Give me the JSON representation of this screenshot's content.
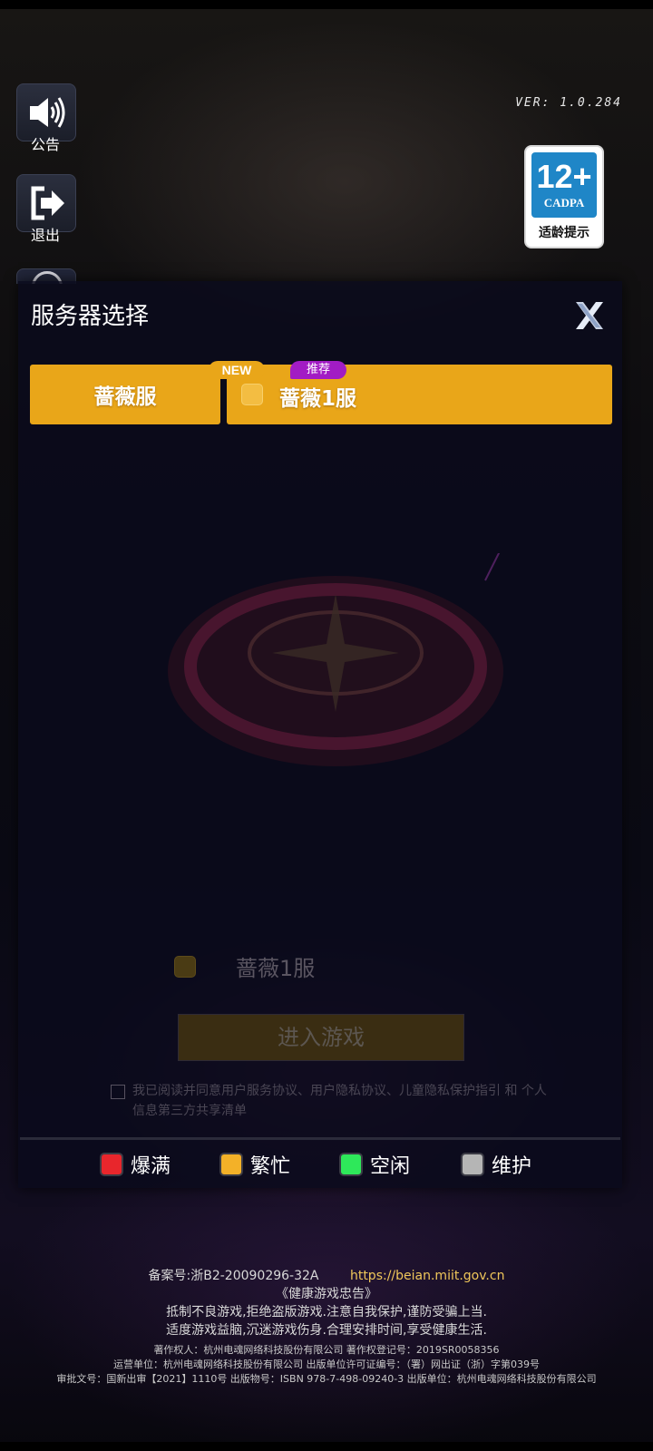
{
  "side_buttons": {
    "announcement": {
      "icon": "speaker-icon",
      "label": "公告"
    },
    "exit": {
      "icon": "exit-icon",
      "label": "退出"
    }
  },
  "version": "VER: 1.0.284",
  "age_rating": {
    "age": "12+",
    "org": "CADPA",
    "tip": "适龄提示",
    "color": "#1f86c7"
  },
  "dialog": {
    "title": "服务器选择",
    "close_icon": "close-x-icon",
    "server_groups": [
      {
        "label": "蔷薇服"
      }
    ],
    "servers": [
      {
        "name": "蔷薇1服",
        "tags": [
          "NEW",
          "推荐"
        ],
        "status": "繁忙"
      }
    ],
    "accent_color": "#e9a619"
  },
  "background": {
    "selected_server": "蔷薇1服",
    "enter_button": "进入游戏",
    "agreement": "我已阅读并同意用户服务协议、用户隐私协议、儿童隐私保护指引 和 个人信息第三方共享清单"
  },
  "legend": [
    {
      "label": "爆满",
      "color": "#e8262c"
    },
    {
      "label": "繁忙",
      "color": "#f3b128"
    },
    {
      "label": "空闲",
      "color": "#2ee85a"
    },
    {
      "label": "维护",
      "color": "#b5b5b5"
    }
  ],
  "footer": {
    "icp": "备案号:浙B2-20090296-32A",
    "icp_url": "https://beian.miit.gov.cn",
    "health_title": "《健康游戏忠告》",
    "advice_line1": "抵制不良游戏,拒绝盗版游戏.注意自我保护,谨防受骗上当.",
    "advice_line2": "适度游戏益脑,沉迷游戏伤身.合理安排时间,享受健康生活.",
    "copyright_line": "著作权人：杭州电魂网络科技股份有限公司 著作权登记号：2019SR0058356",
    "operator_line": "运营单位：杭州电魂网络科技股份有限公司 出版单位许可证编号：（署）网出证（浙）字第039号",
    "approval_line": "审批文号：国新出审【2021】1110号 出版物号：ISBN 978-7-498-09240-3 出版单位：杭州电魂网络科技股份有限公司"
  }
}
